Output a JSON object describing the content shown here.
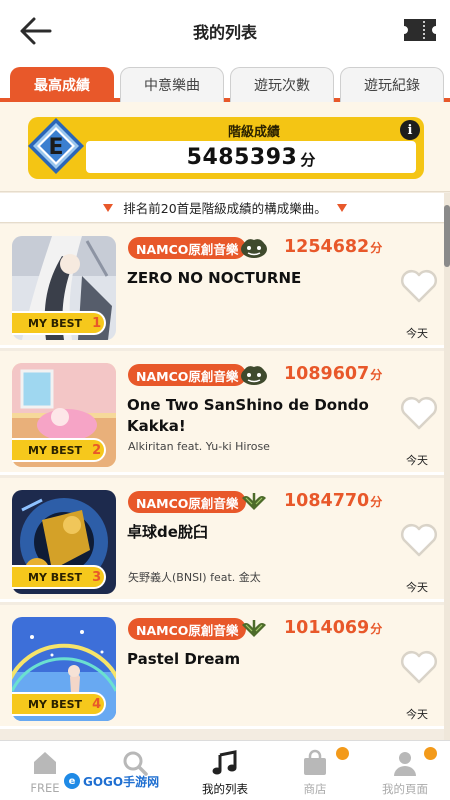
{
  "header": {
    "title": "我的列表",
    "back_icon": "arrow-left-icon",
    "ticket_icon": "ticket-icon"
  },
  "tabs": [
    {
      "label": "最高成績",
      "active": true
    },
    {
      "label": "中意樂曲",
      "active": false
    },
    {
      "label": "遊玩次數",
      "active": false
    },
    {
      "label": "遊玩紀錄",
      "active": false
    }
  ],
  "class_score": {
    "rank": "E",
    "label": "階級成績",
    "value": "5485393",
    "unit": "分",
    "info": "i"
  },
  "notice": "排名前20首是階級成績的構成樂曲。",
  "songs": [
    {
      "badge": "MY BEST",
      "rank": "1",
      "genre": "NAMCO原創音樂",
      "difficulty_icon": "oni-difficulty-icon",
      "score": "1254682",
      "unit": "分",
      "title": "ZERO NO NOCTURNE",
      "artist": "",
      "date": "今天",
      "favorite": false
    },
    {
      "badge": "MY BEST",
      "rank": "2",
      "genre": "NAMCO原創音樂",
      "difficulty_icon": "oni-difficulty-icon",
      "score": "1089607",
      "unit": "分",
      "title": "One Two SanShino de Dondo Kakka!",
      "artist": "Alkiritan feat. Yu-ki Hirose",
      "date": "今天",
      "favorite": false
    },
    {
      "badge": "MY BEST",
      "rank": "3",
      "genre": "NAMCO原創音樂",
      "difficulty_icon": "hard-difficulty-icon",
      "score": "1084770",
      "unit": "分",
      "title": "卓球de脫臼",
      "artist": "矢野義人(BNSI) feat. 金太",
      "date": "今天",
      "favorite": false
    },
    {
      "badge": "MY BEST",
      "rank": "4",
      "genre": "NAMCO原創音樂",
      "difficulty_icon": "hard-difficulty-icon",
      "score": "1014069",
      "unit": "分",
      "title": "Pastel Dream",
      "artist": "",
      "date": "今天",
      "favorite": false
    }
  ],
  "bottom_nav": [
    {
      "label": "FREE",
      "icon": "home-icon",
      "active": false
    },
    {
      "label": "",
      "icon": "search-icon",
      "active": false
    },
    {
      "label": "我的列表",
      "icon": "music-note-icon",
      "active": true
    },
    {
      "label": "商店",
      "icon": "shopping-bag-icon",
      "active": false,
      "badge": true
    },
    {
      "label": "我的頁面",
      "icon": "person-icon",
      "active": false,
      "badge": true
    }
  ],
  "watermark": {
    "text": "GOGO手游网",
    "logo": "e"
  },
  "colors": {
    "accent": "#e8582a",
    "gold": "#f4c514",
    "panel": "#fdf6e9",
    "badge_dot": "#f39a1a"
  }
}
